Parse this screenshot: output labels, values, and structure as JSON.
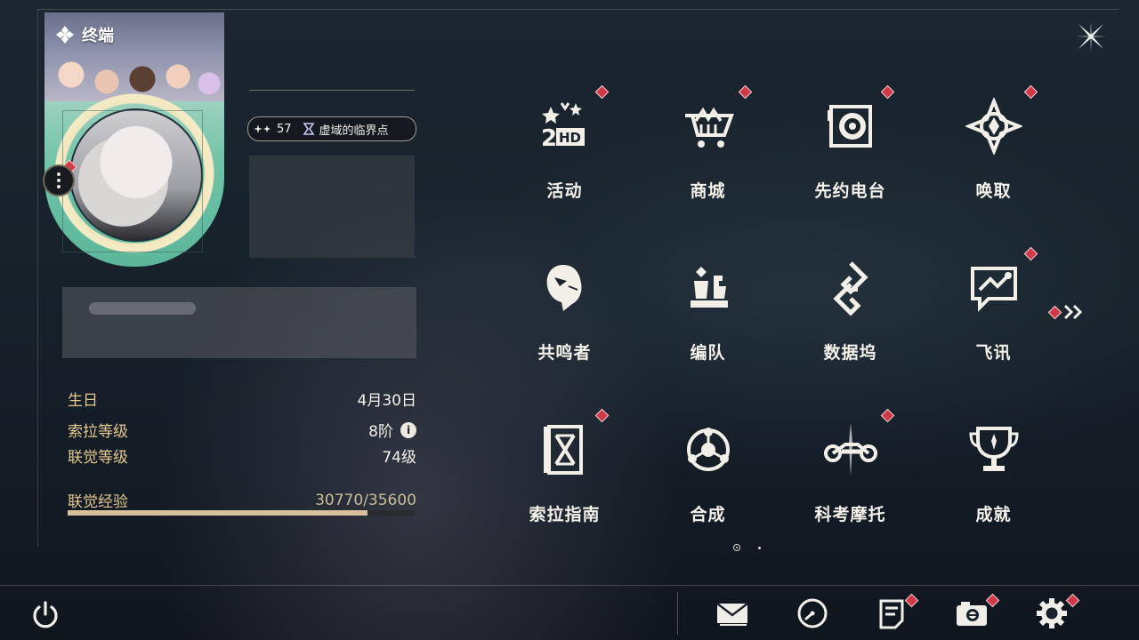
{
  "colors": {
    "accent_gold": "#e3c88f",
    "badge_red": "#d13746",
    "text": "#f4f1ea"
  },
  "profile": {
    "terminal_title": "终端",
    "level": "57",
    "title": "虚域的临界点"
  },
  "stats": {
    "birthday_label": "生日",
    "birthday_value": "4月30日",
    "sola_level_label": "索拉等级",
    "sola_level_value": "8阶",
    "union_level_label": "联觉等级",
    "union_level_value": "74级",
    "union_exp_label": "联觉经验",
    "union_exp_value": "30770/35600",
    "union_exp_progress": 0.864
  },
  "menu": [
    {
      "label": "活动",
      "icon": "event-icon",
      "badge": true
    },
    {
      "label": "商城",
      "icon": "shop-cart-icon",
      "badge": true
    },
    {
      "label": "先约电台",
      "icon": "radio-icon",
      "badge": true
    },
    {
      "label": "唤取",
      "icon": "convene-icon",
      "badge": true
    },
    {
      "label": "共鸣者",
      "icon": "resonator-icon",
      "badge": false
    },
    {
      "label": "编队",
      "icon": "team-icon",
      "badge": false
    },
    {
      "label": "数据坞",
      "icon": "data-dock-icon",
      "badge": false
    },
    {
      "label": "飞讯",
      "icon": "message-icon",
      "badge": true
    },
    {
      "label": "索拉指南",
      "icon": "guidebook-icon",
      "badge": true
    },
    {
      "label": "合成",
      "icon": "synthesis-icon",
      "badge": false
    },
    {
      "label": "科考摩托",
      "icon": "motorcycle-icon",
      "badge": true
    },
    {
      "label": "成就",
      "icon": "trophy-icon",
      "badge": false
    }
  ],
  "pager": {
    "current": 1,
    "total": 2
  },
  "footer": [
    {
      "name": "mail-icon",
      "badge": false
    },
    {
      "name": "clock-icon",
      "badge": false
    },
    {
      "name": "notice-icon",
      "badge": true
    },
    {
      "name": "camera-icon",
      "badge": true
    },
    {
      "name": "settings-gear-icon",
      "badge": true
    }
  ]
}
